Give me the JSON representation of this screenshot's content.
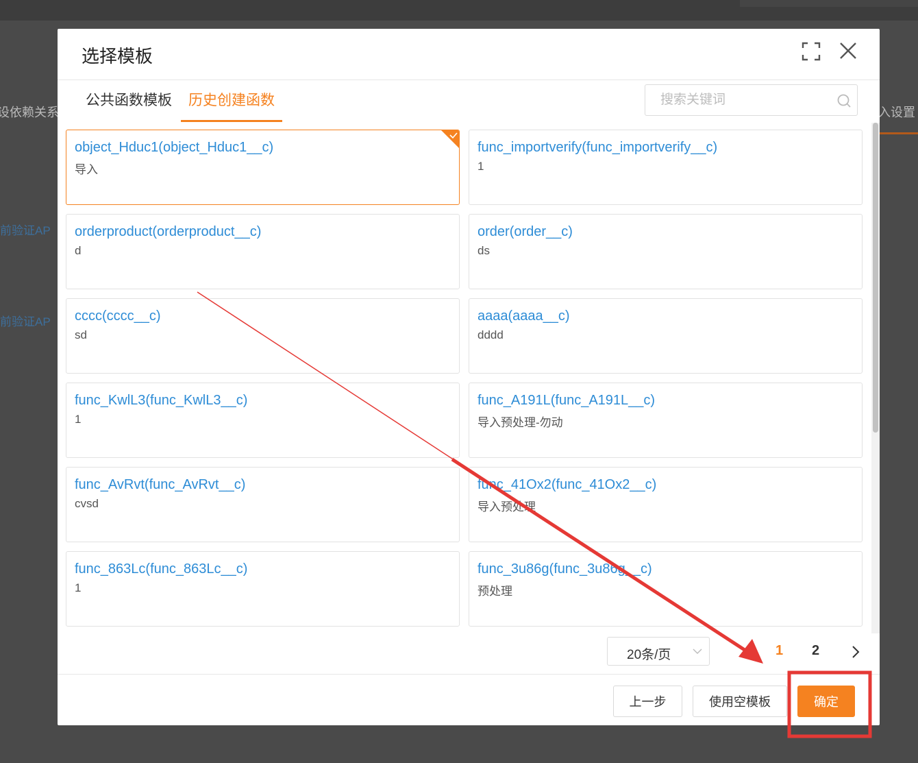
{
  "background": {
    "left_labels": [
      "设依赖关系",
      "前验证AP",
      "前验证AP"
    ],
    "right_label": "入设置"
  },
  "modal": {
    "title": "选择模板",
    "fullscreen_icon": "fullscreen-icon",
    "close_icon": "close-icon"
  },
  "tabs": [
    {
      "label": "公共函数模板",
      "active": false
    },
    {
      "label": "历史创建函数",
      "active": true
    }
  ],
  "search": {
    "placeholder": "搜索关键词",
    "value": "",
    "icon": "search-icon"
  },
  "cards": [
    {
      "title": "object_Hduc1(object_Hduc1__c)",
      "desc": "导入",
      "selected": true
    },
    {
      "title": "func_importverify(func_importverify__c)",
      "desc": "1",
      "selected": false
    },
    {
      "title": "orderproduct(orderproduct__c)",
      "desc": "d",
      "selected": false
    },
    {
      "title": "order(order__c)",
      "desc": "ds",
      "selected": false
    },
    {
      "title": "cccc(cccc__c)",
      "desc": "sd",
      "selected": false
    },
    {
      "title": "aaaa(aaaa__c)",
      "desc": "dddd",
      "selected": false
    },
    {
      "title": "func_KwlL3(func_KwlL3__c)",
      "desc": "1",
      "selected": false
    },
    {
      "title": "func_A191L(func_A191L__c)",
      "desc": "导入预处理-勿动",
      "selected": false
    },
    {
      "title": "func_AvRvt(func_AvRvt__c)",
      "desc": "cvsd",
      "selected": false
    },
    {
      "title": "func_41Ox2(func_41Ox2__c)",
      "desc": "导入预处理",
      "selected": false
    },
    {
      "title": "func_863Lc(func_863Lc__c)",
      "desc": "1",
      "selected": false
    },
    {
      "title": "func_3u86g(func_3u86g__c)",
      "desc": "预处理",
      "selected": false
    }
  ],
  "pagination": {
    "page_size_label": "20条/页",
    "pages": [
      "1",
      "2"
    ],
    "current_page": "1"
  },
  "footer": {
    "prev_label": "上一步",
    "empty_template_label": "使用空模板",
    "confirm_label": "确定"
  },
  "colors": {
    "accent": "#f58220",
    "link": "#2d8cd6",
    "annotation": "#e53935"
  }
}
